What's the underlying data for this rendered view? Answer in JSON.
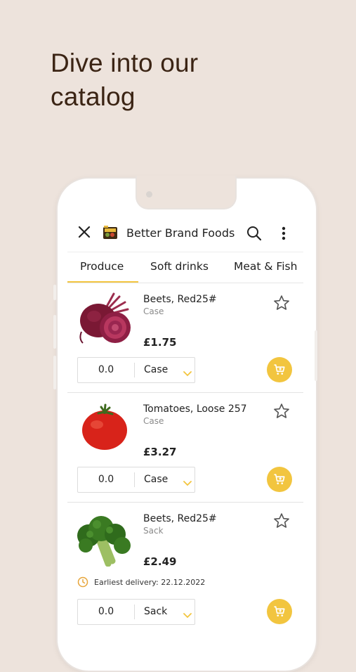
{
  "headline": "Dive into our\ncatalog",
  "header": {
    "store_name": "Better Brand Foods",
    "icons": [
      "close-icon",
      "store-logo",
      "search-icon",
      "more-vert-icon"
    ]
  },
  "tabs": [
    {
      "label": "Produce",
      "active": true
    },
    {
      "label": "Soft drinks",
      "active": false
    },
    {
      "label": "Meat & Fish",
      "active": false
    }
  ],
  "products": [
    {
      "name": "Beets, Red25#",
      "unit_label": "Case",
      "price": "£1.75",
      "qty": "0.0",
      "unit_select": "Case",
      "image": "beetroot-image"
    },
    {
      "name": "Tomatoes, Loose 257",
      "unit_label": "Case",
      "price": "£3.27",
      "qty": "0.0",
      "unit_select": "Case",
      "image": "tomato-image"
    },
    {
      "name": "Beets, Red25#",
      "unit_label": "Sack",
      "price": "£2.49",
      "qty": "0.0",
      "unit_select": "Sack",
      "image": "broccoli-image",
      "delivery": "Earliest delivery: 22.12.2022"
    }
  ],
  "colors": {
    "accent": "#f2c53f",
    "background": "#ede3dc",
    "headline": "#3b2414",
    "delivery_icon": "#e7a53a"
  }
}
